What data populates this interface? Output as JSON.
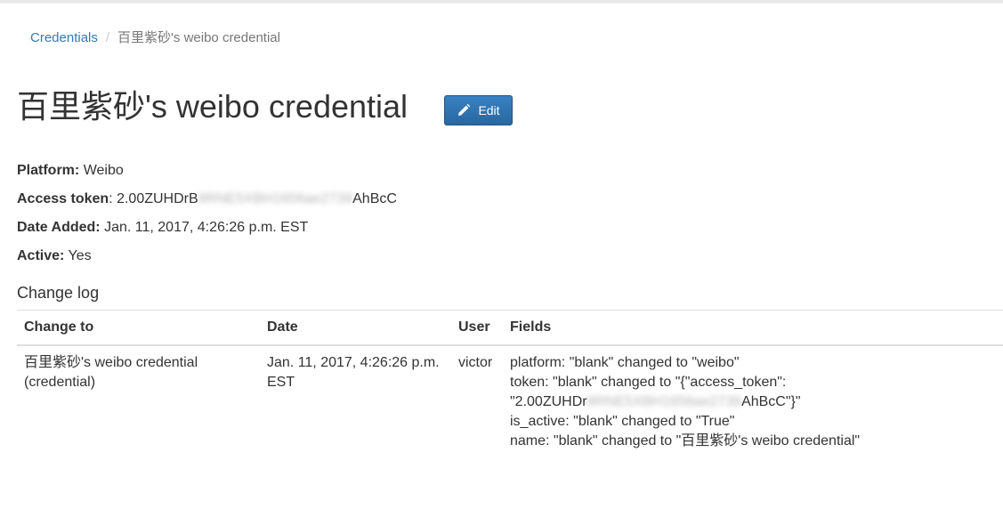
{
  "breadcrumb": {
    "root_label": "Credentials",
    "separator": "/",
    "current_label": "百里紫砂's weibo credential"
  },
  "page": {
    "title": "百里紫砂's weibo credential",
    "edit_label": "Edit",
    "edit_icon": "pencil-icon"
  },
  "details": {
    "platform_label": "Platform:",
    "platform_value": "Weibo",
    "token_label": "Access token",
    "token_colon": ":",
    "token_prefix": "2.00ZUHDrB",
    "token_blurred": "8RNE5XBH1656ae2739",
    "token_suffix": "AhBcC",
    "date_label": "Date Added:",
    "date_value": "Jan. 11, 2017, 4:26:26 p.m. EST",
    "active_label": "Active:",
    "active_value": "Yes"
  },
  "changelog": {
    "heading": "Change log",
    "columns": [
      "Change to",
      "Date",
      "User",
      "Fields"
    ],
    "rows": [
      {
        "change_to_line1": "百里紫砂's weibo credential",
        "change_to_line2": "(credential)",
        "date_line1": "Jan. 11, 2017, 4:26:26 p.m.",
        "date_line2": "EST",
        "user": "victor",
        "fields": {
          "line1": "platform: \"blank\" changed to \"weibo\"",
          "line2": "token: \"blank\" changed to \"{\"access_token\":",
          "line3_prefix": "\"2.00ZUHDr",
          "line3_blurred": "8RNE5XBH1656ae2739",
          "line3_suffix": "AhBcC\"}\"",
          "line4": "is_active: \"blank\" changed to \"True\"",
          "line5": "name: \"blank\" changed to \"百里紫砂's weibo credential\""
        }
      }
    ]
  },
  "colors": {
    "link": "#337ab7",
    "button_bg": "#2e6da4",
    "text": "#333333"
  }
}
